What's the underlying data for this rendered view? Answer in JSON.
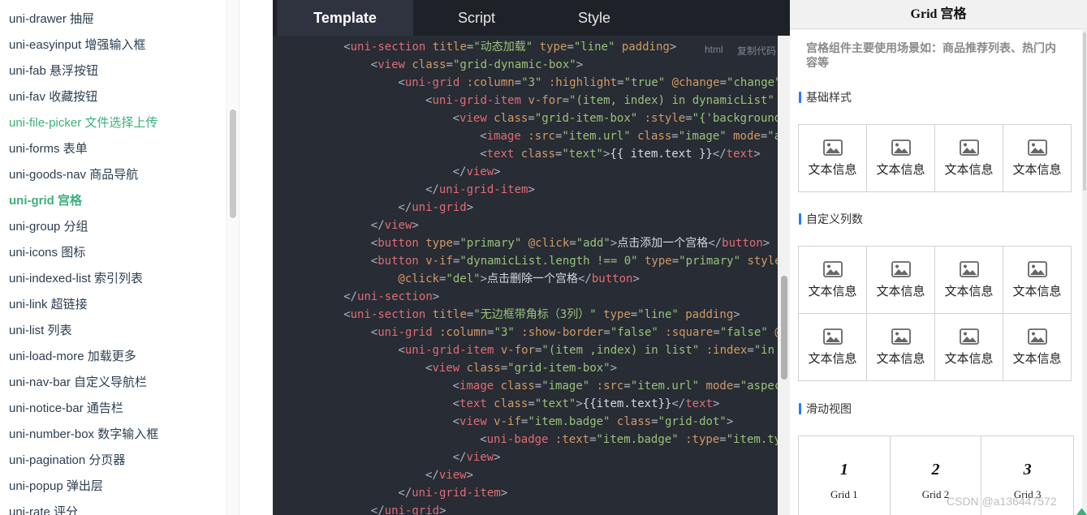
{
  "sidebar": {
    "items": [
      {
        "label": "uni-drawer 抽屉",
        "state": "normal"
      },
      {
        "label": "uni-easyinput 增强输入框",
        "state": "normal"
      },
      {
        "label": "uni-fab 悬浮按钮",
        "state": "normal"
      },
      {
        "label": "uni-fav 收藏按钮",
        "state": "normal"
      },
      {
        "label": "uni-file-picker 文件选择上传",
        "state": "highlight"
      },
      {
        "label": "uni-forms 表单",
        "state": "normal"
      },
      {
        "label": "uni-goods-nav 商品导航",
        "state": "normal"
      },
      {
        "label": "uni-grid 宫格",
        "state": "active"
      },
      {
        "label": "uni-group 分组",
        "state": "normal"
      },
      {
        "label": "uni-icons 图标",
        "state": "normal"
      },
      {
        "label": "uni-indexed-list 索引列表",
        "state": "normal"
      },
      {
        "label": "uni-link 超链接",
        "state": "normal"
      },
      {
        "label": "uni-list 列表",
        "state": "normal"
      },
      {
        "label": "uni-load-more 加载更多",
        "state": "normal"
      },
      {
        "label": "uni-nav-bar 自定义导航栏",
        "state": "normal"
      },
      {
        "label": "uni-notice-bar 通告栏",
        "state": "normal"
      },
      {
        "label": "uni-number-box 数字输入框",
        "state": "normal"
      },
      {
        "label": "uni-pagination 分页器",
        "state": "normal"
      },
      {
        "label": "uni-popup 弹出层",
        "state": "normal"
      },
      {
        "label": "uni-rate 评分",
        "state": "normal"
      }
    ]
  },
  "code_panel": {
    "tabs": [
      "Template",
      "Script",
      "Style"
    ],
    "active_tab": "Template",
    "language": "html",
    "copy_label": "复制代码",
    "lines": [
      {
        "indent": 2,
        "tokens": [
          [
            "punc",
            "<"
          ],
          [
            "tag",
            "uni-section"
          ],
          [
            "attr",
            " title"
          ],
          [
            "punc",
            "="
          ],
          [
            "str",
            "\"动态加载\""
          ],
          [
            "attr",
            " type"
          ],
          [
            "punc",
            "="
          ],
          [
            "str",
            "\"line\""
          ],
          [
            "attr",
            " padding"
          ],
          [
            "punc",
            ">"
          ]
        ]
      },
      {
        "indent": 3,
        "tokens": [
          [
            "punc",
            "<"
          ],
          [
            "tag",
            "view"
          ],
          [
            "attr",
            " class"
          ],
          [
            "punc",
            "="
          ],
          [
            "str",
            "\"grid-dynamic-box\""
          ],
          [
            "punc",
            ">"
          ]
        ]
      },
      {
        "indent": 4,
        "tokens": [
          [
            "punc",
            "<"
          ],
          [
            "tag",
            "uni-grid"
          ],
          [
            "attr",
            " :column"
          ],
          [
            "punc",
            "="
          ],
          [
            "str",
            "\"3\""
          ],
          [
            "attr",
            " :highlight"
          ],
          [
            "punc",
            "="
          ],
          [
            "str",
            "\"true\""
          ],
          [
            "attr",
            " @change"
          ],
          [
            "punc",
            "="
          ],
          [
            "str",
            "\"change\""
          ]
        ]
      },
      {
        "indent": 5,
        "tokens": [
          [
            "punc",
            "<"
          ],
          [
            "tag",
            "uni-grid-item"
          ],
          [
            "attr",
            " v-for"
          ],
          [
            "punc",
            "="
          ],
          [
            "str",
            "\"(item, index) in dynamicList\""
          ]
        ]
      },
      {
        "indent": 6,
        "tokens": [
          [
            "punc",
            "<"
          ],
          [
            "tag",
            "view"
          ],
          [
            "attr",
            " class"
          ],
          [
            "punc",
            "="
          ],
          [
            "str",
            "\"grid-item-box\""
          ],
          [
            "attr",
            " :style"
          ],
          [
            "punc",
            "="
          ],
          [
            "str",
            "\"{'background"
          ]
        ]
      },
      {
        "indent": 7,
        "tokens": [
          [
            "punc",
            "<"
          ],
          [
            "tag",
            "image"
          ],
          [
            "attr",
            " :src"
          ],
          [
            "punc",
            "="
          ],
          [
            "str",
            "\"item.url\""
          ],
          [
            "attr",
            " class"
          ],
          [
            "punc",
            "="
          ],
          [
            "str",
            "\"image\""
          ],
          [
            "attr",
            " mode"
          ],
          [
            "punc",
            "="
          ],
          [
            "str",
            "\"a"
          ]
        ]
      },
      {
        "indent": 7,
        "tokens": [
          [
            "punc",
            "<"
          ],
          [
            "tag",
            "text"
          ],
          [
            "attr",
            " class"
          ],
          [
            "punc",
            "="
          ],
          [
            "str",
            "\"text\""
          ],
          [
            "punc",
            ">"
          ],
          [
            "plain",
            "{{ item.text }}"
          ],
          [
            "punc",
            "</"
          ],
          [
            "tag",
            "text"
          ],
          [
            "punc",
            ">"
          ]
        ]
      },
      {
        "indent": 6,
        "tokens": [
          [
            "punc",
            "</"
          ],
          [
            "tag",
            "view"
          ],
          [
            "punc",
            ">"
          ]
        ]
      },
      {
        "indent": 5,
        "tokens": [
          [
            "punc",
            "</"
          ],
          [
            "tag",
            "uni-grid-item"
          ],
          [
            "punc",
            ">"
          ]
        ]
      },
      {
        "indent": 4,
        "tokens": [
          [
            "punc",
            "</"
          ],
          [
            "tag",
            "uni-grid"
          ],
          [
            "punc",
            ">"
          ]
        ]
      },
      {
        "indent": 3,
        "tokens": [
          [
            "punc",
            "</"
          ],
          [
            "tag",
            "view"
          ],
          [
            "punc",
            ">"
          ]
        ]
      },
      {
        "indent": 3,
        "tokens": [
          [
            "punc",
            "<"
          ],
          [
            "tag",
            "button"
          ],
          [
            "attr",
            " type"
          ],
          [
            "punc",
            "="
          ],
          [
            "str",
            "\"primary\""
          ],
          [
            "attr",
            " @click"
          ],
          [
            "punc",
            "="
          ],
          [
            "str",
            "\"add\""
          ],
          [
            "punc",
            ">"
          ],
          [
            "plain",
            "点击添加一个宫格"
          ],
          [
            "punc",
            "</"
          ],
          [
            "tag",
            "button"
          ],
          [
            "punc",
            ">"
          ]
        ]
      },
      {
        "indent": 3,
        "tokens": [
          [
            "punc",
            "<"
          ],
          [
            "tag",
            "button"
          ],
          [
            "attr",
            " v-if"
          ],
          [
            "punc",
            "="
          ],
          [
            "str",
            "\"dynamicList.length !== 0\""
          ],
          [
            "attr",
            " type"
          ],
          [
            "punc",
            "="
          ],
          [
            "str",
            "\"primary\""
          ],
          [
            "attr",
            " style"
          ]
        ]
      },
      {
        "indent": 4,
        "tokens": [
          [
            "attr",
            "@click"
          ],
          [
            "punc",
            "="
          ],
          [
            "str",
            "\"del\""
          ],
          [
            "punc",
            ">"
          ],
          [
            "plain",
            "点击删除一个宫格"
          ],
          [
            "punc",
            "</"
          ],
          [
            "tag",
            "button"
          ],
          [
            "punc",
            ">"
          ]
        ]
      },
      {
        "indent": 2,
        "tokens": [
          [
            "punc",
            "</"
          ],
          [
            "tag",
            "uni-section"
          ],
          [
            "punc",
            ">"
          ]
        ]
      },
      {
        "indent": 2,
        "tokens": [
          [
            "punc",
            "<"
          ],
          [
            "tag",
            "uni-section"
          ],
          [
            "attr",
            " title"
          ],
          [
            "punc",
            "="
          ],
          [
            "str",
            "\"无边框带角标（3列）\""
          ],
          [
            "attr",
            " type"
          ],
          [
            "punc",
            "="
          ],
          [
            "str",
            "\"line\""
          ],
          [
            "attr",
            " padding"
          ],
          [
            "punc",
            ">"
          ]
        ]
      },
      {
        "indent": 3,
        "tokens": [
          [
            "punc",
            "<"
          ],
          [
            "tag",
            "uni-grid"
          ],
          [
            "attr",
            " :column"
          ],
          [
            "punc",
            "="
          ],
          [
            "str",
            "\"3\""
          ],
          [
            "attr",
            " :show-border"
          ],
          [
            "punc",
            "="
          ],
          [
            "str",
            "\"false\""
          ],
          [
            "attr",
            " :square"
          ],
          [
            "punc",
            "="
          ],
          [
            "str",
            "\"false\""
          ],
          [
            "attr",
            " @"
          ]
        ]
      },
      {
        "indent": 4,
        "tokens": [
          [
            "punc",
            "<"
          ],
          [
            "tag",
            "uni-grid-item"
          ],
          [
            "attr",
            " v-for"
          ],
          [
            "punc",
            "="
          ],
          [
            "str",
            "\"(item ,index) in list\""
          ],
          [
            "attr",
            " :index"
          ],
          [
            "punc",
            "="
          ],
          [
            "str",
            "\"in"
          ]
        ]
      },
      {
        "indent": 5,
        "tokens": [
          [
            "punc",
            "<"
          ],
          [
            "tag",
            "view"
          ],
          [
            "attr",
            " class"
          ],
          [
            "punc",
            "="
          ],
          [
            "str",
            "\"grid-item-box\""
          ],
          [
            "punc",
            ">"
          ]
        ]
      },
      {
        "indent": 6,
        "tokens": [
          [
            "punc",
            "<"
          ],
          [
            "tag",
            "image"
          ],
          [
            "attr",
            " class"
          ],
          [
            "punc",
            "="
          ],
          [
            "str",
            "\"image\""
          ],
          [
            "attr",
            " :src"
          ],
          [
            "punc",
            "="
          ],
          [
            "str",
            "\"item.url\""
          ],
          [
            "attr",
            " mode"
          ],
          [
            "punc",
            "="
          ],
          [
            "str",
            "\"aspec"
          ]
        ]
      },
      {
        "indent": 6,
        "tokens": [
          [
            "punc",
            "<"
          ],
          [
            "tag",
            "text"
          ],
          [
            "attr",
            " class"
          ],
          [
            "punc",
            "="
          ],
          [
            "str",
            "\"text\""
          ],
          [
            "punc",
            ">"
          ],
          [
            "plain",
            "{{item.text}}"
          ],
          [
            "punc",
            "</"
          ],
          [
            "tag",
            "text"
          ],
          [
            "punc",
            ">"
          ]
        ]
      },
      {
        "indent": 6,
        "tokens": [
          [
            "punc",
            "<"
          ],
          [
            "tag",
            "view"
          ],
          [
            "attr",
            " v-if"
          ],
          [
            "punc",
            "="
          ],
          [
            "str",
            "\"item.badge\""
          ],
          [
            "attr",
            " class"
          ],
          [
            "punc",
            "="
          ],
          [
            "str",
            "\"grid-dot\""
          ],
          [
            "punc",
            ">"
          ]
        ]
      },
      {
        "indent": 7,
        "tokens": [
          [
            "punc",
            "<"
          ],
          [
            "tag",
            "uni-badge"
          ],
          [
            "attr",
            " :text"
          ],
          [
            "punc",
            "="
          ],
          [
            "str",
            "\"item.badge\""
          ],
          [
            "attr",
            " :type"
          ],
          [
            "punc",
            "="
          ],
          [
            "str",
            "\"item.ty"
          ]
        ]
      },
      {
        "indent": 6,
        "tokens": [
          [
            "punc",
            "</"
          ],
          [
            "tag",
            "view"
          ],
          [
            "punc",
            ">"
          ]
        ]
      },
      {
        "indent": 5,
        "tokens": [
          [
            "punc",
            "</"
          ],
          [
            "tag",
            "view"
          ],
          [
            "punc",
            ">"
          ]
        ]
      },
      {
        "indent": 4,
        "tokens": [
          [
            "punc",
            "</"
          ],
          [
            "tag",
            "uni-grid-item"
          ],
          [
            "punc",
            ">"
          ]
        ]
      },
      {
        "indent": 3,
        "tokens": [
          [
            "punc",
            "</"
          ],
          [
            "tag",
            "uni-grid"
          ],
          [
            "punc",
            ">"
          ]
        ]
      }
    ]
  },
  "preview": {
    "title": "Grid 宫格",
    "intro": "宫格组件主要使用场景如：商品推荐列表、热门内容等",
    "section_basic": "基础样式",
    "section_custom": "自定义列数",
    "section_swipe": "滑动视图",
    "basic_items": [
      "文本信息",
      "文本信息",
      "文本信息",
      "文本信息"
    ],
    "custom_items": [
      "文本信息",
      "文本信息",
      "文本信息",
      "文本信息",
      "文本信息",
      "文本信息",
      "文本信息",
      "文本信息"
    ],
    "swipe_items": [
      {
        "num": "1",
        "label": "Grid 1"
      },
      {
        "num": "2",
        "label": "Grid 2"
      },
      {
        "num": "3",
        "label": "Grid 3"
      }
    ],
    "cell_icon": "image-icon"
  },
  "watermark": "CSDN @a136447572",
  "colors": {
    "accent": "#3eaf7c",
    "code_bg": "#282c34",
    "section_bar": "#2979ff"
  }
}
